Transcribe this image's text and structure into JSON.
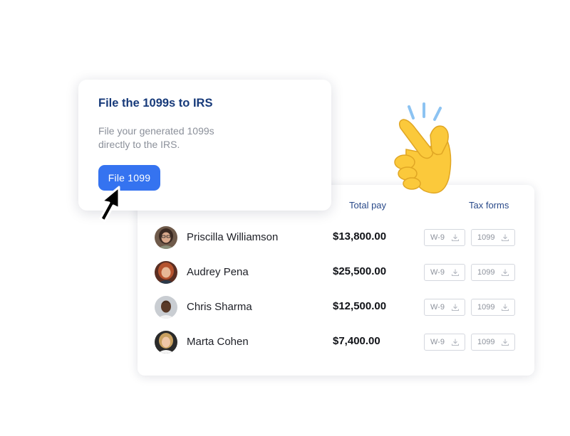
{
  "popup": {
    "title": "File the 1099s to IRS",
    "description": "File your generated 1099s directly to the IRS.",
    "button_label": "File 1099"
  },
  "table": {
    "headers": {
      "total_pay": "Total pay",
      "tax_forms": "Tax forms"
    },
    "form_labels": {
      "w9": "W-9",
      "f1099": "1099"
    },
    "rows": [
      {
        "name": "Priscilla Williamson",
        "total_pay": "$13,800.00"
      },
      {
        "name": "Audrey Pena",
        "total_pay": "$25,500.00"
      },
      {
        "name": "Chris Sharma",
        "total_pay": "$12,500.00"
      },
      {
        "name": "Marta Cohen",
        "total_pay": "$7,400.00"
      }
    ]
  },
  "icons": {
    "download": "download-icon",
    "cursor": "mouse-pointer-icon",
    "hand": "snapping-fingers-emoji"
  },
  "colors": {
    "accent": "#3573f0",
    "title": "#173a7a",
    "header": "#2a4a8a"
  }
}
